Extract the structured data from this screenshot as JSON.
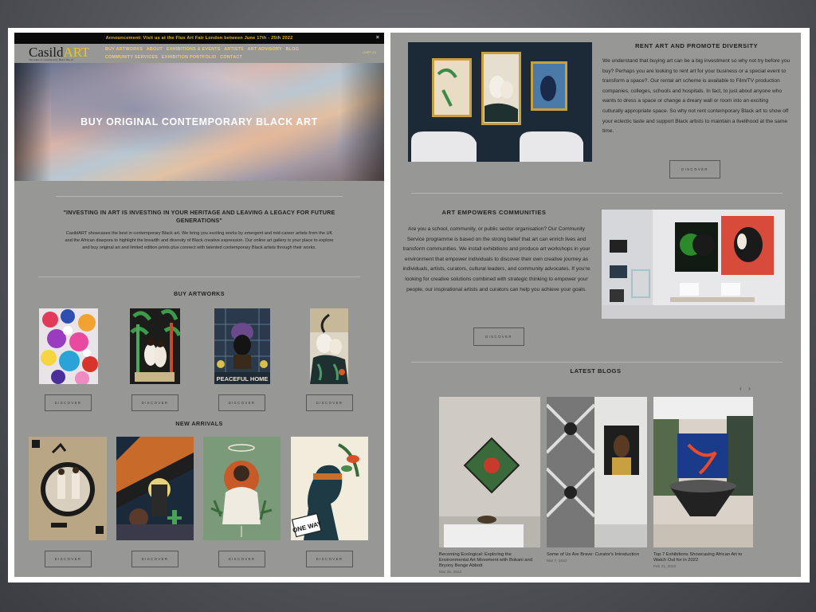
{
  "announcement": {
    "text": "Announcement: Visit us at the Flux Art Fair London between June 17th - 25th 2022",
    "close": "×"
  },
  "logo": {
    "main": "Casild",
    "accent": "ART",
    "tagline": "The home of contemporary Black fine art"
  },
  "nav": {
    "items": [
      "BUY ARTWORKS",
      "ABOUT",
      "EXHIBITIONS & EVENTS",
      "ARTISTS",
      "ART ADVISORY",
      "BLOG",
      "COMMUNITY SERVICES",
      "EXHIBITION PORTFOLIO",
      "CONTACT"
    ],
    "cart": "CART (0)"
  },
  "hero": {
    "title": "BUY ORIGINAL CONTEMPORARY BLACK ART"
  },
  "quote": "\"INVESTING IN ART IS INVESTING IN YOUR HERITAGE AND LEAVING A LEGACY FOR FUTURE GENERATIONS\"",
  "intro": "CasildART showcases the best in contemporary Black art. We bring you exciting works by emergent and mid-career artists from the UK and the African diaspora to highlight the breadth and diversity of Black creative expression. Our online art gallery is your place to explore and buy original art and limited edition prints plus connect with talented contemporary Black artists through their works.",
  "buy_artworks": {
    "title": "BUY ARTWORKS",
    "button": "DISCOVER",
    "artwork_caption": "PEACEFUL HOME"
  },
  "new_arrivals": {
    "title": "NEW ARRIVALS",
    "button": "DISCOVER",
    "sign_text": "ONE WAY"
  },
  "rent": {
    "title": "RENT ART AND PROMOTE DIVERSITY",
    "text": "We understand that buying art can be a big investment so why not try before you buy? Perhaps you are looking to rent art for your business or a special event to transform a space?. Our rental art scheme is available to Film/TV production companies, colleges, schools and hospitals. In fact, to just about anyone who wants to dress a space or change a dreary wall or room into an exciting culturally appropriate space. So why not rent contemporary Black art to show off your eclectic taste and support Black artists to maintain a livelihood at the same time.",
    "button": "DISCOVER"
  },
  "community": {
    "title": "ART EMPOWERS COMMUNITIES",
    "text": "Are you a school, community, or public sector organisation? Our Community Service programme is based on the strong belief that art can enrich lives and transform communities. We install exhibitions and produce art workshops in your environment that empower individuals to discover their own creative journey as individuals, artists, curators, cultural leaders, and community advocates. If you're looking for creative solutions combined with strategic thinking to empower your people, our inspirational artists and curators can help you achieve your goals.",
    "button": "DISCOVER"
  },
  "blogs": {
    "title": "LATEST BLOGS",
    "prev": "‹",
    "next": "›",
    "posts": [
      {
        "title": "Becoming Ecological: Exploring the Environmental Art Movement with Bokani and Bryony Benge Abbott",
        "date": "Mar 25, 2022"
      },
      {
        "title": "Some of Us Are Brave: Curator's Introduction",
        "date": "Mar 7, 2022"
      },
      {
        "title": "Top 7 Exhibitions Showcasing African Art to Watch Out for in 2022",
        "date": "Feb 21, 2022"
      }
    ]
  },
  "colors": {
    "panel_bg": "#979896",
    "announce_bg": "#0a0a0a",
    "accent_gold": "#e0b020",
    "nav_yellow": "#f0d060"
  }
}
